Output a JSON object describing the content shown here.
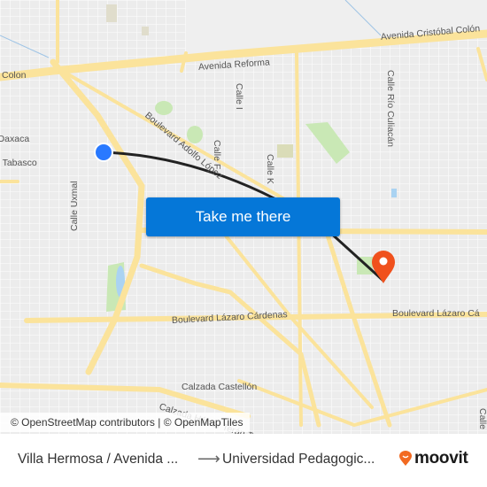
{
  "map": {
    "street_labels": [
      {
        "id": "avenida-cristobal-colon",
        "text": "Avenida Cristóbal Colón"
      },
      {
        "id": "avenida-reforma",
        "text": "Avenida Reforma"
      },
      {
        "id": "colon",
        "text": "Colon"
      },
      {
        "id": "oaxaca",
        "text": "Oaxaca"
      },
      {
        "id": "tabasco",
        "text": "n Tabasco"
      },
      {
        "id": "boulevard-adolfo-lopez",
        "text": "Boulevard Adolfo López"
      },
      {
        "id": "calle-i",
        "text": "Calle I"
      },
      {
        "id": "calle-f",
        "text": "Calle F"
      },
      {
        "id": "calle-k",
        "text": "Calle K"
      },
      {
        "id": "calle-rio-culiacan",
        "text": "Calle Río Culiacán"
      },
      {
        "id": "calle-uxmal",
        "text": "Calle Uxmal"
      },
      {
        "id": "boulevard-lazaro-cardenas-1",
        "text": "Boulevard Lázaro Cárdenas"
      },
      {
        "id": "boulevard-lazaro-cardenas-2",
        "text": "Boulevard Lázaro Cá"
      },
      {
        "id": "calzada-castellon",
        "text": "Calzada Castellón"
      },
      {
        "id": "calzada-teran",
        "text": "Calzada Héctor Terán Terán"
      },
      {
        "id": "calle-edge",
        "text": "Calle"
      }
    ],
    "origin_marker": {
      "label": "origin",
      "color": "#2979ff"
    },
    "destination_marker": {
      "label": "destination",
      "color": "#f0511d"
    },
    "route_color": "#222222",
    "attribution": "© OpenStreetMap contributors | © OpenMapTiles"
  },
  "cta": {
    "label": "Take me there",
    "color": "#0577d8"
  },
  "footer": {
    "origin": "Villa Hermosa / Avenida ...",
    "arrow": "⟶",
    "destination": "Universidad Pedagogic...",
    "brand": "moovit",
    "brand_color": "#f26a21"
  }
}
